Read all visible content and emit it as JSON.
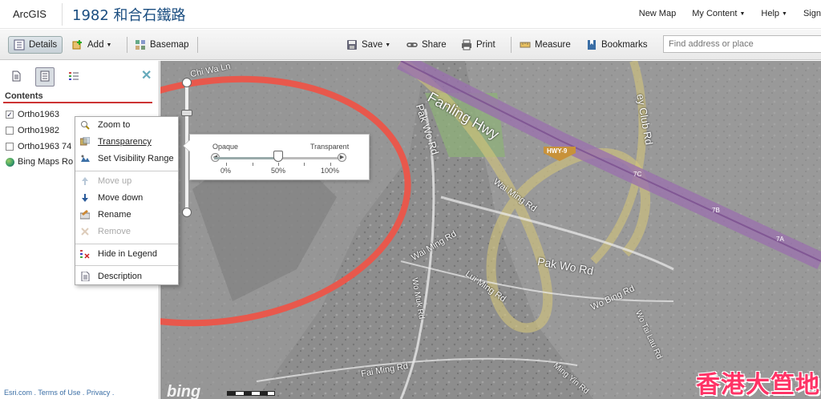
{
  "app": {
    "brand": "ArcGIS",
    "map_title": "1982 和合石鐵路"
  },
  "header_links": [
    "New Map",
    "My Content",
    "Help",
    "Sign"
  ],
  "toolbar": {
    "details": "Details",
    "add": "Add",
    "basemap": "Basemap",
    "save": "Save",
    "share": "Share",
    "print": "Print",
    "measure": "Measure",
    "bookmarks": "Bookmarks",
    "search_placeholder": "Find address or place"
  },
  "sidebar": {
    "title": "Contents",
    "layers": [
      {
        "label": "Ortho1963",
        "checked": true
      },
      {
        "label": "Ortho1982",
        "checked": false
      },
      {
        "label": "Ortho1963 74",
        "checked": false
      },
      {
        "label": "Bing Maps Ro",
        "type": "basemap"
      }
    ],
    "footer": "Esri.com . Terms of Use . Privacy ."
  },
  "context_menu": {
    "items": [
      {
        "label": "Zoom to",
        "icon": "zoom-to-icon",
        "disabled": false
      },
      {
        "label": "Transparency",
        "icon": "transparency-icon",
        "disabled": false
      },
      {
        "label": "Set Visibility Range",
        "icon": "visibility-range-icon",
        "disabled": false
      },
      {
        "label": "Move up",
        "icon": "arrow-up-icon",
        "disabled": true
      },
      {
        "label": "Move down",
        "icon": "arrow-down-icon",
        "disabled": false
      },
      {
        "label": "Rename",
        "icon": "rename-icon",
        "disabled": false
      },
      {
        "label": "Remove",
        "icon": "remove-icon",
        "disabled": true
      },
      {
        "label": "Hide in Legend",
        "icon": "legend-hide-icon",
        "disabled": false
      },
      {
        "label": "Description",
        "icon": "description-icon",
        "disabled": false
      }
    ]
  },
  "transparency": {
    "opaque": "Opaque",
    "transparent": "Transparent",
    "ticks": [
      "0%",
      "50%",
      "100%"
    ],
    "value": 0.5
  },
  "map_labels": {
    "road1": "Fanling Hwy",
    "road2": "Pak Wo Rd",
    "road3": "Wai Ming Rd",
    "road4": "Lui Ming Rd",
    "road5": "Wai Ming Rd",
    "road6": "Pak Wo Rd",
    "road7": "Wo Bing Rd",
    "road8": "Wo Tai Lau Rd",
    "road9": "Fai Ming Rd",
    "road10": "Wo Muk Rd",
    "road11": "Ming Yin Rd",
    "road12": "ey Club Rd",
    "road13": "Chi Wa Ln",
    "shield": "HWY-9",
    "m7c": "7C",
    "m7b": "7B",
    "m7a": "7A",
    "bing": "bing",
    "watermark": "香港大笪地"
  },
  "colors": {
    "highway": "#8a5a9a",
    "minor_road": "#c9b96a",
    "annotation": "#e8584c",
    "park": "#7fa86a"
  }
}
